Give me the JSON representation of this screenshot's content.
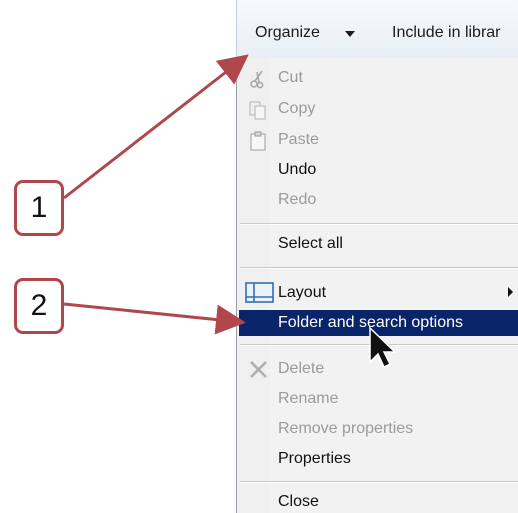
{
  "toolbar": {
    "organize_label": "Organize",
    "include_label": "Include in librar"
  },
  "menu": {
    "items": [
      {
        "label": "Cut",
        "enabled": false,
        "icon": "scissors-icon"
      },
      {
        "label": "Copy",
        "enabled": false,
        "icon": "copy-icon"
      },
      {
        "label": "Paste",
        "enabled": false,
        "icon": "paste-icon"
      },
      {
        "label": "Undo",
        "enabled": true
      },
      {
        "label": "Redo",
        "enabled": false
      },
      {
        "label": "Select all",
        "enabled": true
      },
      {
        "label": "Layout",
        "enabled": true,
        "icon": "layout-icon",
        "has_submenu": true
      },
      {
        "label": "Folder and search options",
        "enabled": true,
        "highlighted": true
      },
      {
        "label": "Delete",
        "enabled": false,
        "icon": "delete-x-icon"
      },
      {
        "label": "Rename",
        "enabled": false
      },
      {
        "label": "Remove properties",
        "enabled": false
      },
      {
        "label": "Properties",
        "enabled": true
      },
      {
        "label": "Close",
        "enabled": true
      }
    ]
  },
  "callouts": {
    "one": "1",
    "two": "2"
  },
  "colors": {
    "highlight": "#0a246a",
    "callout_border": "#b0474d",
    "disabled_text": "#9b9b9b"
  }
}
